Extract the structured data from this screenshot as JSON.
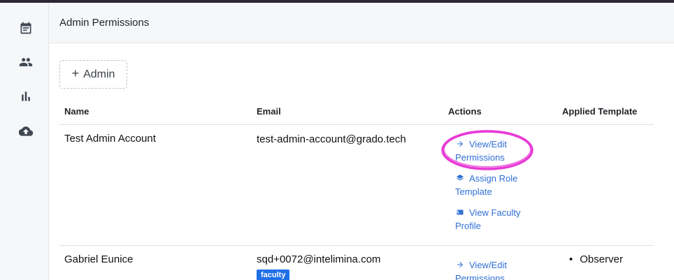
{
  "header": {
    "title": "Admin Permissions"
  },
  "sidebar": {
    "items": [
      {
        "icon": "calendar-icon"
      },
      {
        "icon": "people-icon"
      },
      {
        "icon": "bar-chart-icon"
      },
      {
        "icon": "cloud-upload-icon"
      }
    ]
  },
  "toolbar": {
    "add_admin_label": "Admin",
    "add_icon": "+"
  },
  "table": {
    "columns": [
      "Name",
      "Email",
      "Actions",
      "Applied Template"
    ],
    "rows": [
      {
        "name": "Test Admin Account",
        "email": "test-admin-account@grado.tech",
        "badge": "",
        "actions": [
          {
            "icon": "arrow-right-icon",
            "line1": "View/Edit",
            "line2": "Permissions"
          },
          {
            "icon": "layers-icon",
            "line1": "Assign Role",
            "line2": "Template"
          },
          {
            "icon": "id-card-icon",
            "line1": "View Faculty",
            "line2": "Profile"
          }
        ],
        "templates": []
      },
      {
        "name": "Gabriel Eunice",
        "email": "sqd+0072@intelimina.com",
        "badge": "faculty",
        "actions": [
          {
            "icon": "arrow-right-icon",
            "line1": "View/Edit",
            "line2": "Permissions"
          }
        ],
        "templates": [
          "Observer"
        ]
      }
    ]
  },
  "colors": {
    "accent": "#2f6fd6",
    "badge": "#1e6fe8",
    "highlight": "#e83ad6"
  }
}
